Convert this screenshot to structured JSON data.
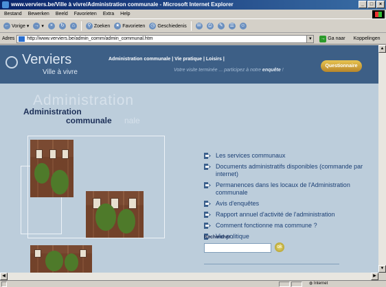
{
  "window": {
    "title": "www.verviers.be/Ville à vivre/Administration communale - Microsoft Internet Explorer",
    "buttons": [
      "_",
      "□",
      "×"
    ]
  },
  "menu": [
    "Bestand",
    "Bewerken",
    "Beeld",
    "Favorieten",
    "Extra",
    "Help"
  ],
  "toolbar": {
    "back": "Vorige",
    "search": "Zoeken",
    "favorites": "Favorieten",
    "history": "Geschiedenis"
  },
  "address": {
    "label": "Adres",
    "url": "http://www.verviers.be/admin_comm/admin_communal.htm",
    "go": "Ga naar",
    "links": "Koppelingen"
  },
  "site": {
    "title": "Verviers",
    "subtitle": "Ville à vivre",
    "nav": [
      "Administration communale",
      "Vie pratique",
      "Loisirs"
    ],
    "survey_text_before": "Votre visite terminée ... participez à notre ",
    "survey_text_bold": "enquête",
    "survey_text_after": " !",
    "survey_button": "Questionnaire"
  },
  "page": {
    "heading_ghost": "Administration",
    "heading_line1": "Administration",
    "heading_line2": "communale",
    "heading_ghost2": "nale"
  },
  "links": [
    "Les services communaux",
    "Documents administratifs disponibles (commande par internet)",
    "Permanences dans les locaux de l'Administration communale",
    "Avis d'enquêtes",
    "Rapport annuel d'activité de l'administration",
    "Comment fonctionne ma commune ?",
    "Vie politique"
  ],
  "search": {
    "label": "Rechercher :",
    "go": "ok"
  },
  "status": {
    "zone": "Internet"
  },
  "colors": {
    "header": "#3d5f86",
    "body": "#bccddb",
    "link": "#1b3f74",
    "survey_button": "#c99a36"
  }
}
